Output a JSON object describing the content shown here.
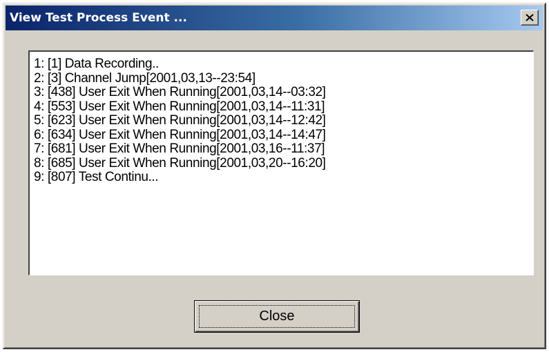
{
  "window": {
    "title": "View Test Process Event ...",
    "close_glyph": "×",
    "close_icon": "close-x-icon"
  },
  "events": [
    "1: [1] Data Recording..",
    "2: [3] Channel Jump[2001,03,13--23:54]",
    "3: [438] User Exit When Running[2001,03,14--03:32]",
    "4: [553] User Exit When Running[2001,03,14--11:31]",
    "5: [623] User Exit When Running[2001,03,14--12:42]",
    "6: [634] User Exit When Running[2001,03,14--14:47]",
    "7: [681] User Exit When Running[2001,03,16--11:37]",
    "8: [685] User Exit When Running[2001,03,20--16:20]",
    "9: [807] Test Continu..."
  ],
  "buttons": {
    "close_label": "Close"
  },
  "colors": {
    "title_start": "#0a246a",
    "title_end": "#a6caf0",
    "face": "#d4d0c8"
  }
}
